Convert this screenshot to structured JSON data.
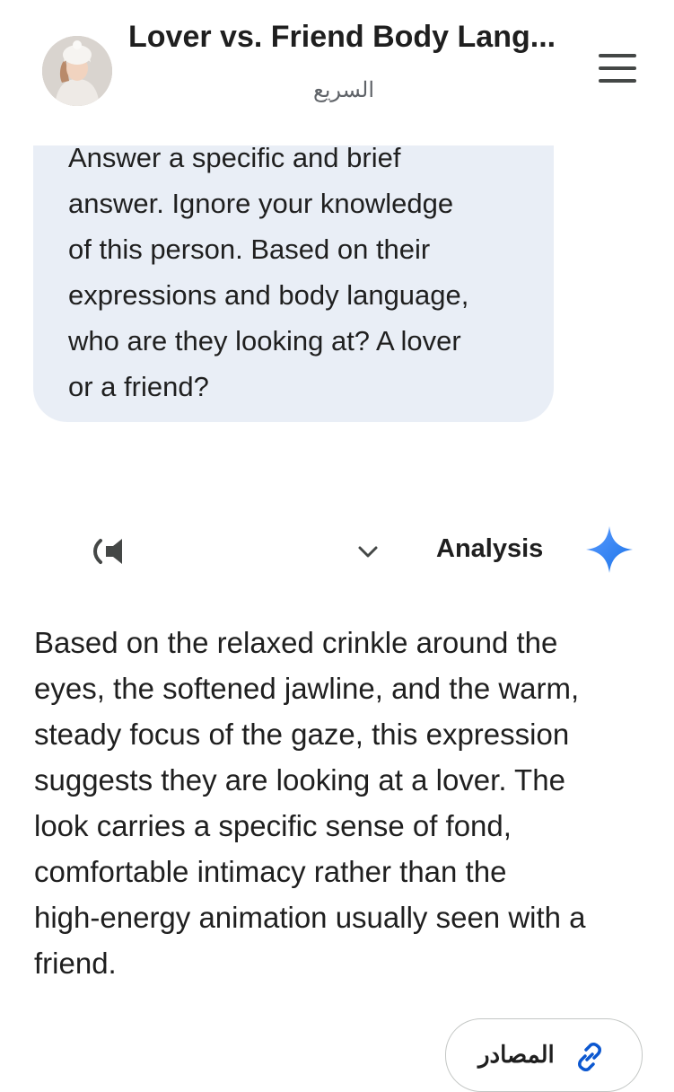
{
  "header": {
    "title": "Lover vs. Friend Body Lang...",
    "subtitle": "السريع"
  },
  "user_message": {
    "lines": [
      "Answer a specific and brief",
      "answer. Ignore your knowledge",
      "of this person. Based on their",
      "expressions and body language,",
      "who are they looking at? A lover",
      "or a friend?"
    ]
  },
  "response_header": {
    "label": "Analysis",
    "icons": [
      "speaker-icon",
      "chevron-down-icon",
      "gemini-sparkle-icon"
    ],
    "accent_color": "#4285f4"
  },
  "answer": {
    "lines": [
      "Based on the relaxed crinkle around the",
      "eyes, the softened jawline, and the warm,",
      "steady focus of the gaze, this expression",
      "suggests they are looking at a lover. The",
      "look carries a specific sense of fond,",
      "comfortable intimacy rather than the",
      "high-energy animation usually seen with a",
      "friend."
    ]
  },
  "sources": {
    "label": "المصادر",
    "icon": "link-icon",
    "icon_color": "#0b57d0"
  }
}
